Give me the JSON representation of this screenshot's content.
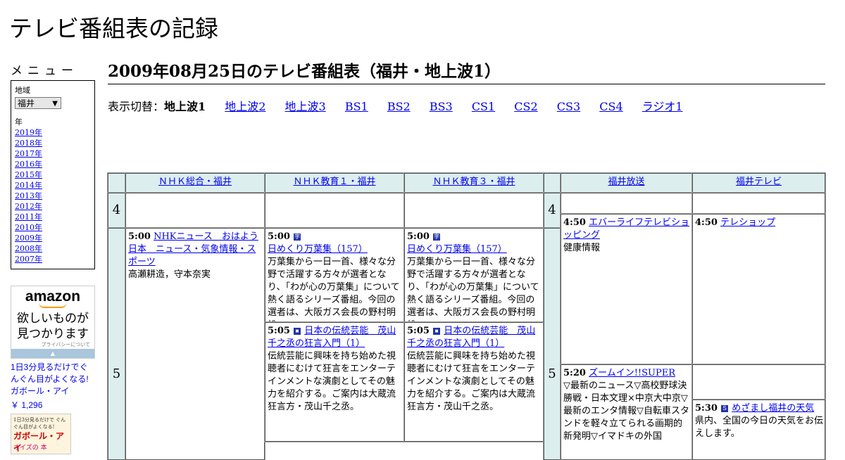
{
  "site_title": "テレビ番組表の記録",
  "sidebar": {
    "menu_label": "メニュー",
    "region_label": "地域",
    "region_value": "福井",
    "year_label": "年",
    "years": [
      "2019年",
      "2018年",
      "2017年",
      "2016年",
      "2015年",
      "2014年",
      "2013年",
      "2012年",
      "2011年",
      "2010年",
      "2009年",
      "2008年",
      "2007年"
    ]
  },
  "ad": {
    "logo": "amazon",
    "catch_line1": "欲しいものが",
    "catch_line2": "見つかります",
    "privacy": "プライバシーについて",
    "product": "1日3分見るだけでぐんぐん目がよくなる! ガボール・アイ",
    "price": "￥ 1,296",
    "thumb_line1": "1日3分見るだけで ぐんぐん目がよくなる!",
    "thumb_line2": "ガボール・アイ",
    "thumb_line3": "オイズの 本"
  },
  "page_title": "2009年08月25日のテレビ番組表（福井・地上波1）",
  "switcher": {
    "label": "表示切替：",
    "current": "地上波1",
    "links": [
      "地上波2",
      "地上波3",
      "BS1",
      "BS2",
      "BS3",
      "CS1",
      "CS2",
      "CS3",
      "CS4",
      "ラジオ1"
    ]
  },
  "grid": {
    "channels": [
      "ＮＨＫ総合・福井",
      "ＮＨＫ教育１・福井",
      "ＮＨＫ教育３・福井",
      "福井放送",
      "福井テレビ"
    ],
    "hours": [
      "4",
      "5",
      "4",
      "5"
    ],
    "programs": {
      "nhk_g_500": {
        "time": "5:00",
        "title": "NHKニュース　おはよう日本　ニュース・気象情報・スポーツ",
        "desc": "高瀬耕造，守本奈実"
      },
      "e1_500": {
        "time": "5:00",
        "icon": "字",
        "title": "日めくり万葉集（157）",
        "desc": "万葉集から一日一首、様々な分野で活躍する方々が選者となり、「わが心の万葉集」について熱く語るシリーズ番組。今回の選者は、大阪ガス会長の野村明雄。"
      },
      "e3_500": {
        "time": "5:00",
        "icon": "字",
        "title": "日めくり万葉集（157）",
        "desc": "万葉集から一日一首、様々な分野で活躍する方々が選者となり、「わが心の万葉集」について熱く語るシリーズ番組。今回の選者は、大阪ガス会長の野村明雄。"
      },
      "e1_505": {
        "time": "5:05",
        "icon": "■",
        "title": "日本の伝統芸能　茂山千之丞の狂言入門（1）",
        "desc": "伝統芸能に興味を持ち始めた視聴者にむけて狂言をエンターテインメントな演劇としてその魅力を紹介する。ご案内は大蔵流狂言方・茂山千之丞。"
      },
      "e3_505": {
        "time": "5:05",
        "icon": "■",
        "title": "日本の伝統芸能　茂山千之丞の狂言入門（1）",
        "desc": "伝統芸能に興味を持ち始めた視聴者にむけて狂言をエンターテインメントな演劇としてその魅力を紹介する。ご案内は大蔵流狂言方・茂山千之丞。"
      },
      "fbc_450": {
        "time": "4:50",
        "title": "エバーライフテレビショッピング",
        "desc": "健康情報"
      },
      "fbc_520": {
        "time": "5:20",
        "title": "ズームイン!!SUPER",
        "desc": "▽最新のニュース▽高校野球決勝戦・日本文理×中京大中京▽最新のエンタ情報▽自転車スタンドを軽々立てられる画期的新発明▽イマドキの外国"
      },
      "ftb_450": {
        "time": "4:50",
        "title": "テレショップ",
        "desc": ""
      },
      "ftb_530": {
        "time": "5:30",
        "icon": "S",
        "title": "めざまし福井の天気",
        "desc": "県内、全国の今日の天気をお伝えします。"
      }
    }
  }
}
